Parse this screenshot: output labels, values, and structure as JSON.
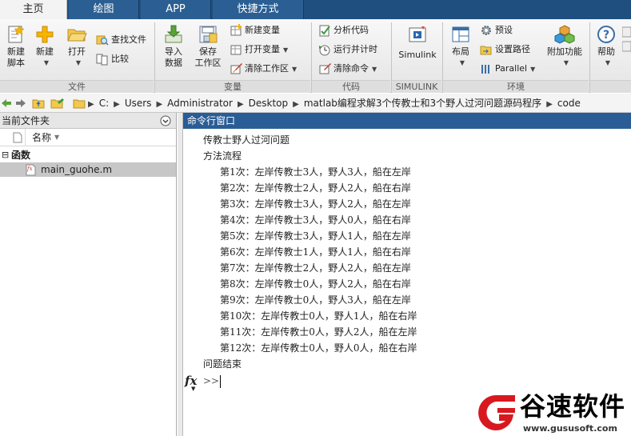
{
  "tabs": [
    {
      "label": "主页",
      "active": true
    },
    {
      "label": "绘图",
      "active": false
    },
    {
      "label": "APP",
      "active": false
    },
    {
      "label": "快捷方式",
      "active": false
    }
  ],
  "ribbon": {
    "groups": {
      "file": "文件",
      "variable": "变量",
      "code": "代码",
      "simulink": "SIMULINK",
      "environment": "环境"
    },
    "new_script": [
      "新建",
      "脚本"
    ],
    "new": "新建",
    "open": "打开",
    "find_files": "查找文件",
    "compare": "比较",
    "import_data": [
      "导入",
      "数据"
    ],
    "save_workspace": [
      "保存",
      "工作区"
    ],
    "new_variable": "新建变量",
    "open_variable": "打开变量",
    "clear_workspace": "清除工作区",
    "analyze_code": "分析代码",
    "run_and_time": "运行并计时",
    "clear_commands": "清除命令",
    "simulink": "Simulink",
    "layout": "布局",
    "preferences": "预设",
    "set_path": "设置路径",
    "parallel": "Parallel",
    "addons": "附加功能",
    "help": "帮助"
  },
  "address": {
    "segments": [
      "C:",
      "Users",
      "Administrator",
      "Desktop",
      "matlab编程求解3个传教士和3个野人过河问题源码程序",
      "code"
    ]
  },
  "current_folder": {
    "title": "当前文件夹",
    "column_name": "名称",
    "group": "函数",
    "files": [
      "main_guohe.m"
    ]
  },
  "command_window": {
    "title": "命令行窗口",
    "lines": [
      "传教士野人过河问题",
      "方法流程",
      "第1次：左岸传教士3人，野人3人，船在左岸",
      "第2次：左岸传教士2人，野人2人，船在右岸",
      "第3次：左岸传教士3人，野人2人，船在左岸",
      "第4次：左岸传教士3人，野人0人，船在右岸",
      "第5次：左岸传教士3人，野人1人，船在左岸",
      "第6次：左岸传教士1人，野人1人，船在右岸",
      "第7次：左岸传教士2人，野人2人，船在左岸",
      "第8次：左岸传教士0人，野人2人，船在右岸",
      "第9次：左岸传教士0人，野人3人，船在左岸",
      "第10次：左岸传教士0人，野人1人，船在右岸",
      "第11次：左岸传教士0人，野人2人，船在左岸",
      "第12次：左岸传教士0人，野人0人，船在右岸",
      "问题结束"
    ],
    "fx": "fx",
    "prompt": ">>"
  },
  "watermark": {
    "name": "谷速软件",
    "url": "www.gususoft.com",
    "color": "#d7191f"
  }
}
